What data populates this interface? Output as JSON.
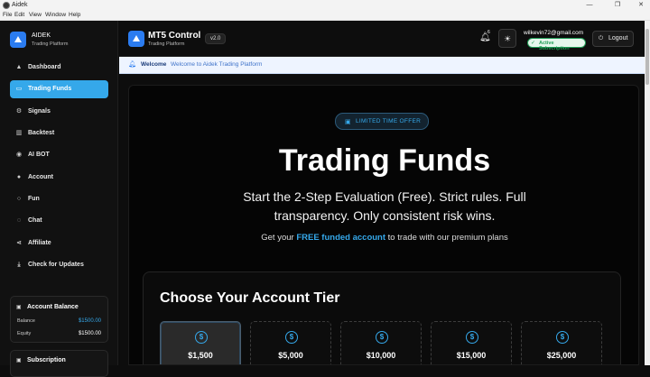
{
  "os": {
    "window_title": "Aidek",
    "menu": [
      "File",
      "Edit",
      "View",
      "Window",
      "Help"
    ]
  },
  "sidebar": {
    "brand": "AIDEK",
    "brand_sub": "Trading Platform",
    "items": [
      {
        "label": "Dashboard",
        "icon": "triangle-icon"
      },
      {
        "label": "Trading Funds",
        "icon": "card-icon",
        "active": true
      },
      {
        "label": "Signals",
        "icon": "gear-icon"
      },
      {
        "label": "Backtest",
        "icon": "bar-chart-icon"
      },
      {
        "label": "AI BOT",
        "icon": "pin-icon"
      },
      {
        "label": "Account",
        "icon": "user-icon"
      },
      {
        "label": "Fun",
        "icon": "circle-icon"
      },
      {
        "label": "Chat",
        "icon": "chat-icon"
      },
      {
        "label": "Affiliate",
        "icon": "share-icon"
      },
      {
        "label": "Check for Updates",
        "icon": "download-icon"
      }
    ],
    "balance": {
      "title": "Account Balance",
      "balance_label": "Balance",
      "balance_value": "$1500.00",
      "equity_label": "Equity",
      "equity_value": "$1500.00"
    },
    "subscription_title": "Subscription"
  },
  "header": {
    "title": "MT5 Control",
    "subtitle": "Trading Platform",
    "version": "v2.0",
    "notification_count": "6",
    "email": "wilkevin72@gmail.com",
    "subscription_badge": "Active Subscription",
    "logout_label": "Logout"
  },
  "welcome": {
    "label": "Welcome",
    "message": "Welcome to Aidek Trading Platform"
  },
  "main": {
    "offer_badge": "LIMITED TIME OFFER",
    "title": "Trading Funds",
    "lead_line1": "Start the 2-Step Evaluation (Free). Strict rules. Full",
    "lead_line2": "transparency. Only consistent risk wins.",
    "sub_prefix": "Get your ",
    "sub_highlight": "FREE funded account",
    "sub_suffix": " to trade with our premium plans",
    "tier_heading": "Choose Your Account Tier",
    "tiers": [
      {
        "amount": "$1,500",
        "selected": true
      },
      {
        "amount": "$5,000"
      },
      {
        "amount": "$10,000"
      },
      {
        "amount": "$15,000"
      },
      {
        "amount": "$25,000"
      }
    ]
  },
  "colors": {
    "accent": "#35a8ea",
    "brand_blue": "#2b7cf0",
    "success": "#1f9d55"
  }
}
